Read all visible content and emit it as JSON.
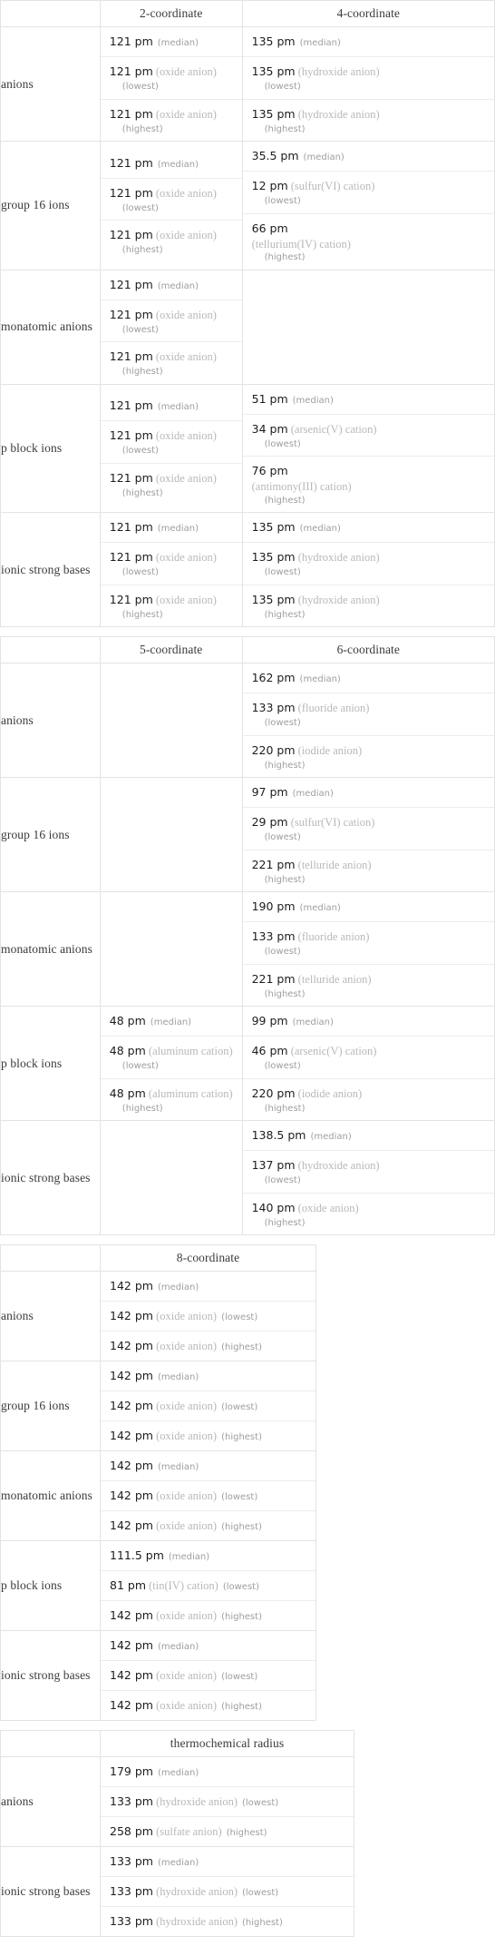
{
  "tables": [
    {
      "id": "coord-2-4",
      "headers": [
        "",
        "2-coordinate",
        "4-coordinate"
      ],
      "layout": "stacked",
      "rows": [
        {
          "label": "anions",
          "cells": [
            [
              {
                "value": "121 pm",
                "species": "",
                "qual": "(median)",
                "style": "median"
              },
              {
                "value": "121 pm",
                "species": "(oxide anion)",
                "qual": "(lowest)",
                "style": "below"
              },
              {
                "value": "121 pm",
                "species": "(oxide anion)",
                "qual": "(highest)",
                "style": "below"
              }
            ],
            [
              {
                "value": "135 pm",
                "species": "",
                "qual": "(median)",
                "style": "median"
              },
              {
                "value": "135 pm",
                "species": "(hydroxide anion)",
                "qual": "(lowest)",
                "style": "below"
              },
              {
                "value": "135 pm",
                "species": "(hydroxide anion)",
                "qual": "(highest)",
                "style": "below"
              }
            ]
          ]
        },
        {
          "label": "group 16 ions",
          "cells": [
            [
              {
                "value": "121 pm",
                "species": "",
                "qual": "(median)",
                "style": "median"
              },
              {
                "value": "121 pm",
                "species": "(oxide anion)",
                "qual": "(lowest)",
                "style": "below"
              },
              {
                "value": "121 pm",
                "species": "(oxide anion)",
                "qual": "(highest)",
                "style": "below"
              }
            ],
            [
              {
                "value": "35.5 pm",
                "species": "",
                "qual": "(median)",
                "style": "median"
              },
              {
                "value": "12 pm",
                "species": "(sulfur(VI) cation)",
                "qual": "(lowest)",
                "style": "below"
              },
              {
                "value": "66 pm",
                "species": "(tellurium(IV) cation)",
                "qual": "(highest)",
                "style": "wrap"
              }
            ]
          ]
        },
        {
          "label": "monatomic anions",
          "cells": [
            [
              {
                "value": "121 pm",
                "species": "",
                "qual": "(median)",
                "style": "median"
              },
              {
                "value": "121 pm",
                "species": "(oxide anion)",
                "qual": "(lowest)",
                "style": "below"
              },
              {
                "value": "121 pm",
                "species": "(oxide anion)",
                "qual": "(highest)",
                "style": "below"
              }
            ],
            []
          ]
        },
        {
          "label": "p block ions",
          "cells": [
            [
              {
                "value": "121 pm",
                "species": "",
                "qual": "(median)",
                "style": "median"
              },
              {
                "value": "121 pm",
                "species": "(oxide anion)",
                "qual": "(lowest)",
                "style": "below"
              },
              {
                "value": "121 pm",
                "species": "(oxide anion)",
                "qual": "(highest)",
                "style": "below"
              }
            ],
            [
              {
                "value": "51 pm",
                "species": "",
                "qual": "(median)",
                "style": "median"
              },
              {
                "value": "34 pm",
                "species": "(arsenic(V) cation)",
                "qual": "(lowest)",
                "style": "below"
              },
              {
                "value": "76 pm",
                "species": "(antimony(III) cation)",
                "qual": "(highest)",
                "style": "wrap"
              }
            ]
          ]
        },
        {
          "label": "ionic strong bases",
          "cells": [
            [
              {
                "value": "121 pm",
                "species": "",
                "qual": "(median)",
                "style": "median"
              },
              {
                "value": "121 pm",
                "species": "(oxide anion)",
                "qual": "(lowest)",
                "style": "below"
              },
              {
                "value": "121 pm",
                "species": "(oxide anion)",
                "qual": "(highest)",
                "style": "below"
              }
            ],
            [
              {
                "value": "135 pm",
                "species": "",
                "qual": "(median)",
                "style": "median"
              },
              {
                "value": "135 pm",
                "species": "(hydroxide anion)",
                "qual": "(lowest)",
                "style": "below"
              },
              {
                "value": "135 pm",
                "species": "(hydroxide anion)",
                "qual": "(highest)",
                "style": "below"
              }
            ]
          ]
        }
      ]
    },
    {
      "id": "coord-5-6",
      "headers": [
        "",
        "5-coordinate",
        "6-coordinate"
      ],
      "layout": "stacked",
      "rows": [
        {
          "label": "anions",
          "cells": [
            [],
            [
              {
                "value": "162 pm",
                "species": "",
                "qual": "(median)",
                "style": "median"
              },
              {
                "value": "133 pm",
                "species": "(fluoride anion)",
                "qual": "(lowest)",
                "style": "below"
              },
              {
                "value": "220 pm",
                "species": "(iodide anion)",
                "qual": "(highest)",
                "style": "below"
              }
            ]
          ]
        },
        {
          "label": "group 16 ions",
          "cells": [
            [],
            [
              {
                "value": "97 pm",
                "species": "",
                "qual": "(median)",
                "style": "median"
              },
              {
                "value": "29 pm",
                "species": "(sulfur(VI) cation)",
                "qual": "(lowest)",
                "style": "below"
              },
              {
                "value": "221 pm",
                "species": "(telluride anion)",
                "qual": "(highest)",
                "style": "below"
              }
            ]
          ]
        },
        {
          "label": "monatomic anions",
          "cells": [
            [],
            [
              {
                "value": "190 pm",
                "species": "",
                "qual": "(median)",
                "style": "median"
              },
              {
                "value": "133 pm",
                "species": "(fluoride anion)",
                "qual": "(lowest)",
                "style": "below"
              },
              {
                "value": "221 pm",
                "species": "(telluride anion)",
                "qual": "(highest)",
                "style": "below"
              }
            ]
          ]
        },
        {
          "label": "p block ions",
          "cells": [
            [
              {
                "value": "48 pm",
                "species": "",
                "qual": "(median)",
                "style": "median"
              },
              {
                "value": "48 pm",
                "species": "(aluminum cation)",
                "qual": "(lowest)",
                "style": "below"
              },
              {
                "value": "48 pm",
                "species": "(aluminum cation)",
                "qual": "(highest)",
                "style": "below"
              }
            ],
            [
              {
                "value": "99 pm",
                "species": "",
                "qual": "(median)",
                "style": "median"
              },
              {
                "value": "46 pm",
                "species": "(arsenic(V) cation)",
                "qual": "(lowest)",
                "style": "below"
              },
              {
                "value": "220 pm",
                "species": "(iodide anion)",
                "qual": "(highest)",
                "style": "below"
              }
            ]
          ]
        },
        {
          "label": "ionic strong bases",
          "cells": [
            [],
            [
              {
                "value": "138.5 pm",
                "species": "",
                "qual": "(median)",
                "style": "median"
              },
              {
                "value": "137 pm",
                "species": "(hydroxide anion)",
                "qual": "(lowest)",
                "style": "below"
              },
              {
                "value": "140 pm",
                "species": "(oxide anion)",
                "qual": "(highest)",
                "style": "below"
              }
            ]
          ]
        }
      ]
    },
    {
      "id": "coord-8",
      "headers": [
        "",
        "8-coordinate"
      ],
      "layout": "inline",
      "rows": [
        {
          "label": "anions",
          "cells": [
            [
              {
                "value": "142 pm",
                "species": "",
                "qual": "(median)",
                "style": "median"
              },
              {
                "value": "142 pm",
                "species": "(oxide anion)",
                "qual": "(lowest)",
                "style": "inline"
              },
              {
                "value": "142 pm",
                "species": "(oxide anion)",
                "qual": "(highest)",
                "style": "inline"
              }
            ]
          ]
        },
        {
          "label": "group 16 ions",
          "cells": [
            [
              {
                "value": "142 pm",
                "species": "",
                "qual": "(median)",
                "style": "median"
              },
              {
                "value": "142 pm",
                "species": "(oxide anion)",
                "qual": "(lowest)",
                "style": "inline"
              },
              {
                "value": "142 pm",
                "species": "(oxide anion)",
                "qual": "(highest)",
                "style": "inline"
              }
            ]
          ]
        },
        {
          "label": "monatomic anions",
          "cells": [
            [
              {
                "value": "142 pm",
                "species": "",
                "qual": "(median)",
                "style": "median"
              },
              {
                "value": "142 pm",
                "species": "(oxide anion)",
                "qual": "(lowest)",
                "style": "inline"
              },
              {
                "value": "142 pm",
                "species": "(oxide anion)",
                "qual": "(highest)",
                "style": "inline"
              }
            ]
          ]
        },
        {
          "label": "p block ions",
          "cells": [
            [
              {
                "value": "111.5 pm",
                "species": "",
                "qual": "(median)",
                "style": "median"
              },
              {
                "value": "81 pm",
                "species": "(tin(IV) cation)",
                "qual": "(lowest)",
                "style": "inline"
              },
              {
                "value": "142 pm",
                "species": "(oxide anion)",
                "qual": "(highest)",
                "style": "inline"
              }
            ]
          ]
        },
        {
          "label": "ionic strong bases",
          "cells": [
            [
              {
                "value": "142 pm",
                "species": "",
                "qual": "(median)",
                "style": "median"
              },
              {
                "value": "142 pm",
                "species": "(oxide anion)",
                "qual": "(lowest)",
                "style": "inline"
              },
              {
                "value": "142 pm",
                "species": "(oxide anion)",
                "qual": "(highest)",
                "style": "inline"
              }
            ]
          ]
        }
      ]
    },
    {
      "id": "thermochemical-radius",
      "headers": [
        "",
        "thermochemical radius"
      ],
      "layout": "inline",
      "rows": [
        {
          "label": "anions",
          "cells": [
            [
              {
                "value": "179 pm",
                "species": "",
                "qual": "(median)",
                "style": "median"
              },
              {
                "value": "133 pm",
                "species": "(hydroxide anion)",
                "qual": "(lowest)",
                "style": "inline"
              },
              {
                "value": "258 pm",
                "species": "(sulfate anion)",
                "qual": "(highest)",
                "style": "inline"
              }
            ]
          ]
        },
        {
          "label": "ionic strong bases",
          "cells": [
            [
              {
                "value": "133 pm",
                "species": "",
                "qual": "(median)",
                "style": "median"
              },
              {
                "value": "133 pm",
                "species": "(hydroxide anion)",
                "qual": "(lowest)",
                "style": "inline"
              },
              {
                "value": "133 pm",
                "species": "(hydroxide anion)",
                "qual": "(highest)",
                "style": "inline"
              }
            ]
          ]
        }
      ]
    }
  ]
}
